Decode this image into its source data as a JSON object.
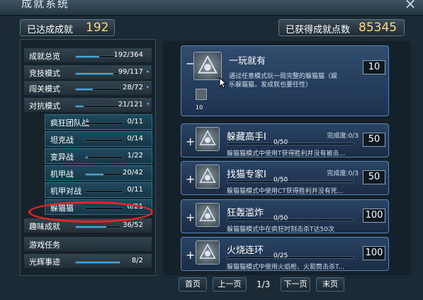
{
  "window": {
    "title": "成就系统",
    "close_glyph": "×"
  },
  "summary": {
    "achieved_label": "已达成成就",
    "achieved_value": "192",
    "points_label": "已获得成就点数",
    "points_value": "85345"
  },
  "nav": [
    {
      "name": "成就总览",
      "count": "192/364",
      "progress": 0.53,
      "arrow": ""
    },
    {
      "name": "竞技模式",
      "count": "99/117",
      "progress": 0.85,
      "arrow": "▸"
    },
    {
      "name": "闯关模式",
      "count": "28/72",
      "progress": 0.39,
      "arrow": "▸"
    },
    {
      "name": "对抗模式",
      "count": "21/121",
      "progress": 0.17,
      "arrow": "▾"
    },
    {
      "name": "疯狂团队战",
      "count": "0/11",
      "progress": 0.0,
      "arrow": ""
    },
    {
      "name": "坦克战",
      "count": "0/14",
      "progress": 0.0,
      "arrow": ""
    },
    {
      "name": "变异战",
      "count": "1/22",
      "progress": 0.05,
      "arrow": ""
    },
    {
      "name": "机甲战",
      "count": "20/42",
      "progress": 0.48,
      "arrow": ""
    },
    {
      "name": "机甲对战",
      "count": "0/11",
      "progress": 0.0,
      "arrow": ""
    },
    {
      "name": "躲猫猫",
      "count": "0/21",
      "progress": 0.0,
      "arrow": ""
    },
    {
      "name": "趣味成就",
      "count": "36/52",
      "progress": 0.69,
      "arrow": ""
    },
    {
      "name": "游戏任务",
      "count": "",
      "progress": null,
      "arrow": ""
    },
    {
      "name": "光辉事迹",
      "count": "8/2",
      "progress": 1.0,
      "arrow": ""
    }
  ],
  "cards": [
    {
      "toggle": "−",
      "name": "一玩就有",
      "desc": "通过任意模式玩一局完整的躲猫猫（娱乐躲猫猫，发成就也要任性）",
      "points": "10",
      "completion": "",
      "progress_text": "",
      "mini_value": "10"
    },
    {
      "toggle": "+",
      "name": "躲藏高手I",
      "desc": "躲猫猫模式中使用T获得胜利并没有被击...",
      "points": "50",
      "completion": "完成度:0/3",
      "progress_text": "0/50",
      "mini_value": ""
    },
    {
      "toggle": "+",
      "name": "找猫专家I",
      "desc": "躲猫猫模式中使用CT获得胜利并没有死...",
      "points": "50",
      "completion": "完成度:0/3",
      "progress_text": "0/50",
      "mini_value": ""
    },
    {
      "toggle": "+",
      "name": "狂轰滥炸",
      "desc": "躲猫猫模式中在疯狂时刻击杀T达50次",
      "points": "100",
      "completion": "",
      "progress_text": "0/50",
      "mini_value": ""
    },
    {
      "toggle": "+",
      "name": "火烧连环",
      "desc": "躲猫猫模式中使用火焰枪、火箭筒击杀T...",
      "points": "100",
      "completion": "",
      "progress_text": "0/25",
      "mini_value": ""
    }
  ],
  "pager": {
    "first": "首页",
    "prev": "上一页",
    "info": "1/3",
    "next": "下一页",
    "last": "末页"
  },
  "colors": {
    "accent": "#3ea9e4",
    "gold": "#ffd878",
    "highlight": "#e22525"
  }
}
